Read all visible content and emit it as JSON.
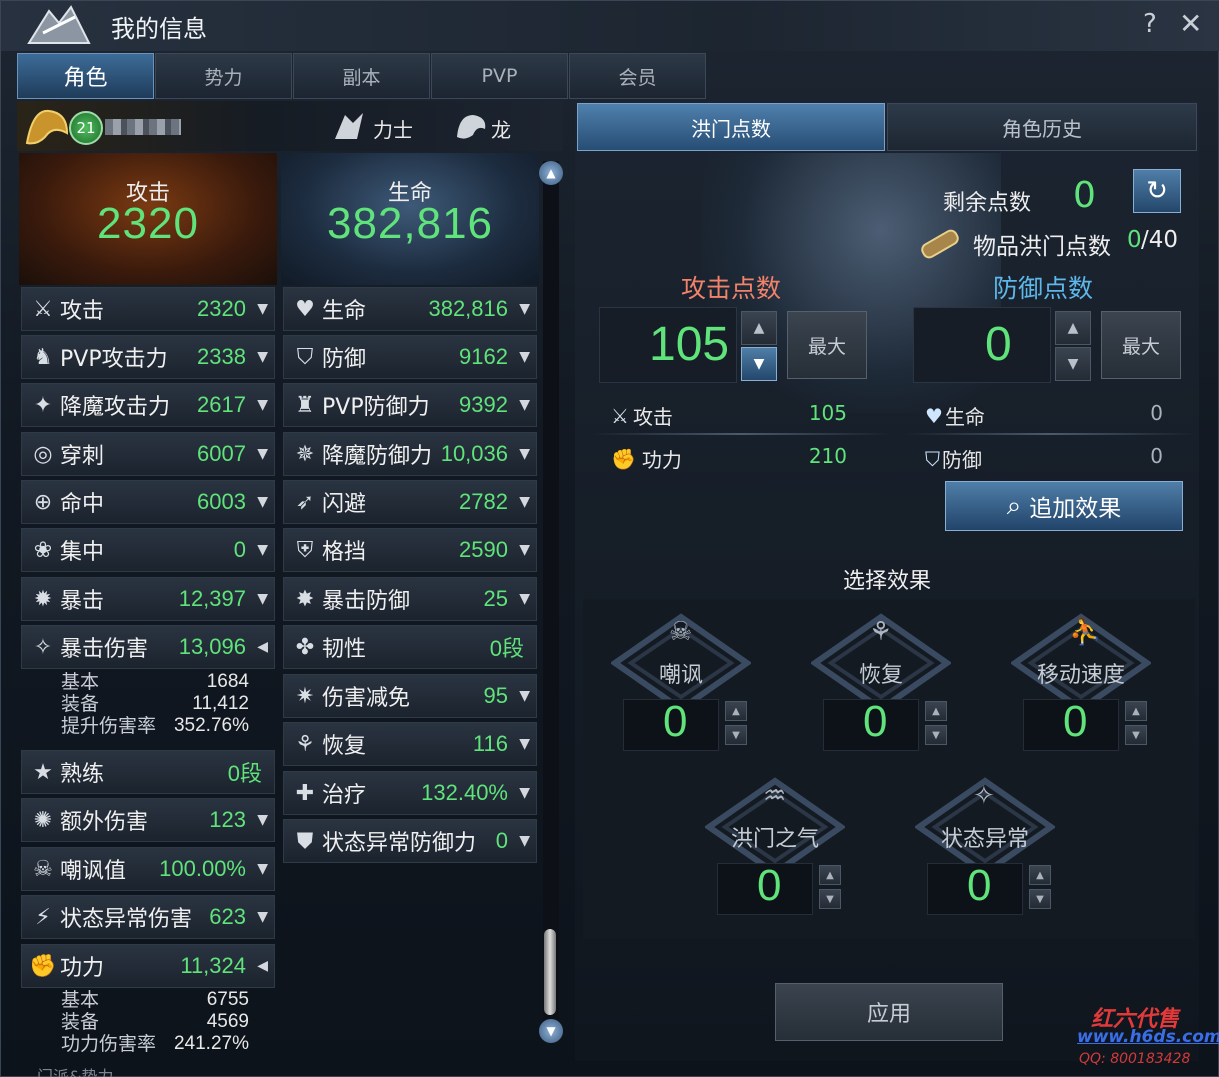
{
  "window": {
    "title": "我的信息",
    "help": "?",
    "close": "✕"
  },
  "tabs": [
    "角色",
    "势力",
    "副本",
    "PVP",
    "会员"
  ],
  "character": {
    "level": "21",
    "class": "力士",
    "race": "龙"
  },
  "summary": {
    "attack_label": "攻击",
    "attack_value": "2320",
    "hp_label": "生命",
    "hp_value": "382,816"
  },
  "left_stats": [
    {
      "label": "攻击",
      "value": "2320",
      "icon": "crossed-swords-icon",
      "arrow": "▼"
    },
    {
      "label": "PVP攻击力",
      "value": "2338",
      "icon": "pvp-attack-icon",
      "arrow": "▼"
    },
    {
      "label": "降魔攻击力",
      "value": "2617",
      "icon": "demon-attack-icon",
      "arrow": "▼"
    },
    {
      "label": "穿刺",
      "value": "6007",
      "icon": "pierce-icon",
      "arrow": "▼"
    },
    {
      "label": "命中",
      "value": "6003",
      "icon": "target-icon",
      "arrow": "▼"
    },
    {
      "label": "集中",
      "value": "0",
      "icon": "focus-icon",
      "arrow": "▼"
    },
    {
      "label": "暴击",
      "value": "12,397",
      "icon": "critical-icon",
      "arrow": "▼"
    },
    {
      "label": "暴击伤害",
      "value": "13,096",
      "icon": "critical-damage-icon",
      "arrow": "◀"
    },
    {
      "label": "熟练",
      "value": "0段",
      "icon": "mastery-icon",
      "arrow": ""
    },
    {
      "label": "额外伤害",
      "value": "123",
      "icon": "extra-damage-icon",
      "arrow": "▼"
    },
    {
      "label": "嘲讽值",
      "value": "100.00%",
      "icon": "skull-icon",
      "arrow": "▼"
    },
    {
      "label": "状态异常伤害",
      "value": "623",
      "icon": "status-damage-icon",
      "arrow": "▼"
    },
    {
      "label": "功力",
      "value": "11,324",
      "icon": "power-fist-icon",
      "arrow": "◀"
    }
  ],
  "crit_damage_detail": [
    {
      "label": "基本",
      "value": "1684"
    },
    {
      "label": "装备",
      "value": "11,412"
    },
    {
      "label": "提升伤害率",
      "value": "352.76%"
    }
  ],
  "power_detail": [
    {
      "label": "基本",
      "value": "6755"
    },
    {
      "label": "装备",
      "value": "4569"
    },
    {
      "label": "功力伤害率",
      "value": "241.27%"
    }
  ],
  "right_stats": [
    {
      "label": "生命",
      "value": "382,816",
      "icon": "heart-icon",
      "arrow": "▼"
    },
    {
      "label": "防御",
      "value": "9162",
      "icon": "shield-icon",
      "arrow": "▼"
    },
    {
      "label": "PVP防御力",
      "value": "9392",
      "icon": "pvp-defense-icon",
      "arrow": "▼"
    },
    {
      "label": "降魔防御力",
      "value": "10,036",
      "icon": "demon-defense-icon",
      "arrow": "▼"
    },
    {
      "label": "闪避",
      "value": "2782",
      "icon": "evade-icon",
      "arrow": "▼"
    },
    {
      "label": "格挡",
      "value": "2590",
      "icon": "block-icon",
      "arrow": "▼"
    },
    {
      "label": "暴击防御",
      "value": "25",
      "icon": "crit-defense-icon",
      "arrow": "▼"
    },
    {
      "label": "韧性",
      "value": "0段",
      "icon": "tenacity-icon",
      "arrow": ""
    },
    {
      "label": "伤害减免",
      "value": "95",
      "icon": "damage-reduction-icon",
      "arrow": "▼"
    },
    {
      "label": "恢复",
      "value": "116",
      "icon": "sprout-icon",
      "arrow": "▼"
    },
    {
      "label": "治疗",
      "value": "132.40%",
      "icon": "heal-icon",
      "arrow": "▼"
    },
    {
      "label": "状态异常防御力",
      "value": "0",
      "icon": "status-defense-icon",
      "arrow": "▼"
    }
  ],
  "footer_text": "门派&势力",
  "right": {
    "tab_points": "洪门点数",
    "tab_history": "角色历史",
    "remaining_label": "剩余点数",
    "remaining_value": "0",
    "item_label": "物品洪门点数",
    "item_value": "0",
    "item_max": "/40",
    "attack_points_label": "攻击点数",
    "defense_points_label": "防御点数",
    "attack_points": "105",
    "defense_points": "0",
    "max_label": "最大",
    "attack_effects": [
      {
        "label": "攻击",
        "value": "105",
        "icon": "crossed-swords-icon"
      },
      {
        "label": "功力",
        "value": "210",
        "icon": "power-fist-icon"
      }
    ],
    "defense_effects": [
      {
        "label": "生命",
        "value": "0",
        "icon": "heart-icon"
      },
      {
        "label": "防御",
        "value": "0",
        "icon": "shield-icon"
      }
    ],
    "add_effect_label": "追加效果",
    "select_effect_title": "选择效果",
    "effects": [
      {
        "label": "嘲讽",
        "value": "0",
        "icon": "skull-icon"
      },
      {
        "label": "恢复",
        "value": "0",
        "icon": "sprout-icon"
      },
      {
        "label": "移动速度",
        "value": "0",
        "icon": "running-icon"
      },
      {
        "label": "洪门之气",
        "value": "0",
        "icon": "dragon-icon"
      },
      {
        "label": "状态异常",
        "value": "0",
        "icon": "stars-icon"
      }
    ],
    "apply_label": "应用"
  },
  "watermark": {
    "line1": "红六代售",
    "line2": "www.h6ds.com",
    "line3": "QQ: 800183428"
  },
  "colors": {
    "green": "#5fe37a",
    "accent_blue": "#4f7ea8",
    "attack_red": "#f2836a",
    "defense_blue": "#5db7ea"
  }
}
